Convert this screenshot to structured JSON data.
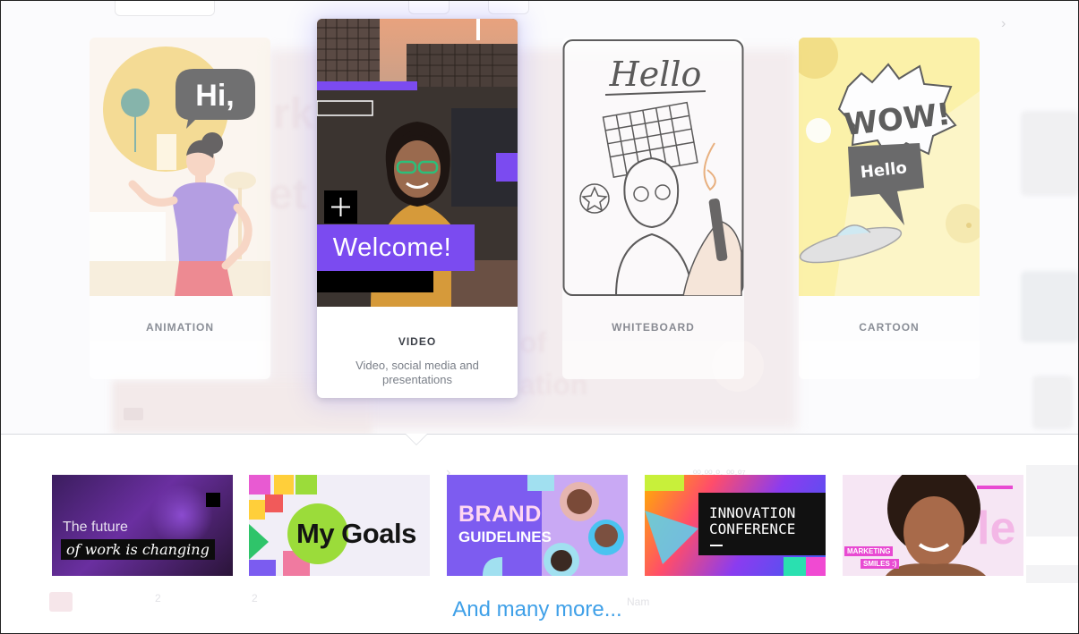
{
  "styles": [
    {
      "label": "ANIMATION"
    },
    {
      "label": "VIDEO",
      "description": "Video, social media and presentations",
      "overlay_text": "Welcome!"
    },
    {
      "label": "WHITEBOARD",
      "art_text": "Hello"
    },
    {
      "label": "CARTOON",
      "art_text_1": "WOW!",
      "art_text_2": "Hello"
    }
  ],
  "animation_bubble": "Hi,",
  "templates": [
    {
      "line1": "The future",
      "line2": "of work is changing"
    },
    {
      "text": "My Goals"
    },
    {
      "line1": "BRAND",
      "line2": "GUIDELINES"
    },
    {
      "line1": "INNOVATION",
      "line2": "CONFERENCE"
    },
    {
      "badge1": "MARKETING",
      "badge2": "SMILES :)"
    }
  ],
  "more_link": "And many more...",
  "colors": {
    "accent_purple": "#7b4bf0",
    "link_blue": "#3fa0e8",
    "cartoon_yellow": "#fcee8a"
  }
}
